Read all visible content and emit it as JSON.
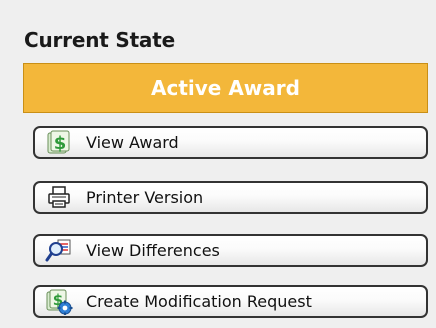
{
  "panel": {
    "title": "Current State",
    "state_label": "Active Award",
    "state_color": "#f3b73a"
  },
  "actions": [
    {
      "label": "View Award",
      "icon": "money-document-icon"
    },
    {
      "label": "Printer Version",
      "icon": "printer-icon"
    },
    {
      "label": "View Differences",
      "icon": "compare-magnifier-icon"
    },
    {
      "label": "Create Modification Request",
      "icon": "money-gear-icon"
    }
  ]
}
